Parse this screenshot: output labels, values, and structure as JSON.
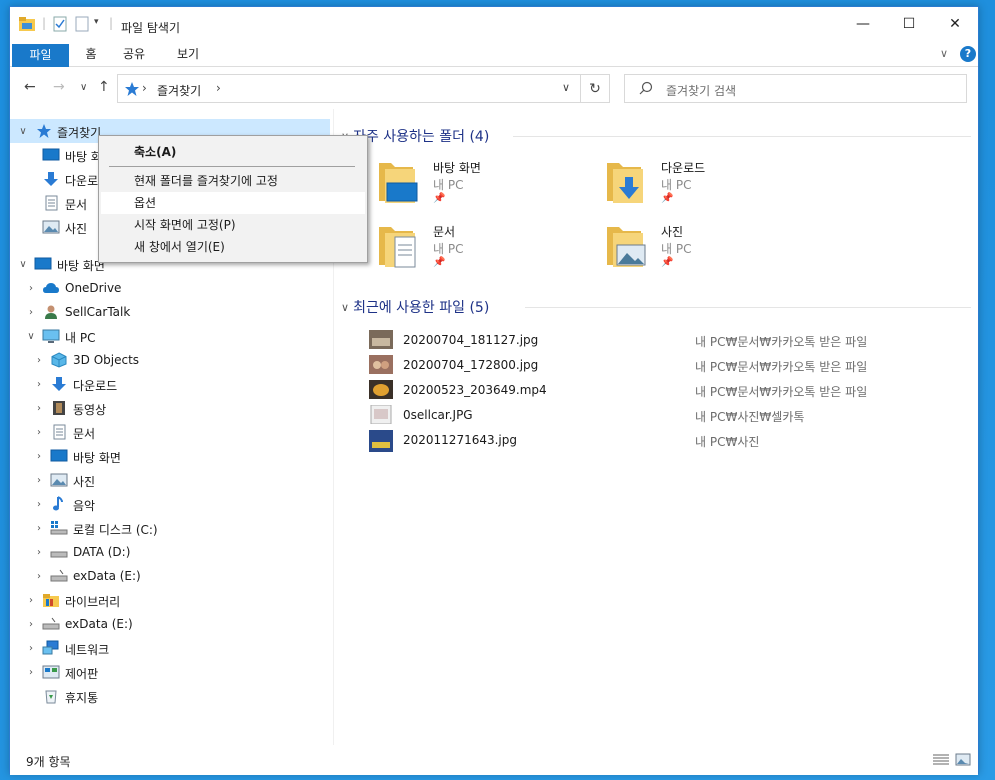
{
  "window": {
    "title": "파일 탐색기",
    "minimize_glyph": "—",
    "maximize_glyph": "☐",
    "close_glyph": "✕"
  },
  "ribbon": {
    "tabs": [
      "파일",
      "홈",
      "공유",
      "보기"
    ],
    "expand_glyph": "∨",
    "help_glyph": "?"
  },
  "nav": {
    "back": "←",
    "forward": "→",
    "recent": "∨",
    "up": "↑",
    "address_path": "즐겨찾기",
    "address_sep": "›",
    "search_placeholder": "즐겨찾기 검색"
  },
  "tree": {
    "favorites": "즐겨찾기",
    "fav_items": [
      "바탕 화면",
      "다운로드",
      "문서",
      "사진"
    ],
    "desktop": "바탕 화면",
    "onedrive": "OneDrive",
    "user": "SellCarTalk",
    "mypc": "내 PC",
    "pc_items": [
      "3D Objects",
      "다운로드",
      "동영상",
      "문서",
      "바탕 화면",
      "사진",
      "음악",
      "로컬 디스크 (C:)",
      "DATA (D:)",
      "exData (E:)"
    ],
    "library": "라이브러리",
    "exdata": "exData (E:)",
    "network": "네트워크",
    "control": "제어판",
    "trash": "휴지통"
  },
  "context_menu": {
    "items": [
      "축소(A)",
      "현재 폴더를 즐겨찾기에 고정",
      "옵션",
      "시작 화면에 고정(P)",
      "새 창에서 열기(E)"
    ]
  },
  "frequent": {
    "header": "자주 사용하는 폴더 (4)",
    "folders": [
      {
        "name": "바탕 화면",
        "location": "내 PC"
      },
      {
        "name": "다운로드",
        "location": "내 PC"
      },
      {
        "name": "문서",
        "location": "내 PC"
      },
      {
        "name": "사진",
        "location": "내 PC"
      }
    ]
  },
  "recent": {
    "header": "최근에 사용한 파일 (5)",
    "files": [
      {
        "name": "20200704_181127.jpg",
        "path": "내 PC₩문서₩카카오톡 받은 파일"
      },
      {
        "name": "20200704_172800.jpg",
        "path": "내 PC₩문서₩카카오톡 받은 파일"
      },
      {
        "name": "20200523_203649.mp4",
        "path": "내 PC₩문서₩카카오톡 받은 파일"
      },
      {
        "name": "0sellcar.JPG",
        "path": "내 PC₩사진₩셀카톡"
      },
      {
        "name": "202011271643.jpg",
        "path": "내 PC₩사진"
      }
    ]
  },
  "status": {
    "item_count": "9개 항목"
  },
  "colors": {
    "accent": "#1979ca",
    "selection": "#cce8ff",
    "group_header": "#1e3287",
    "folder": "#f6c94e"
  }
}
